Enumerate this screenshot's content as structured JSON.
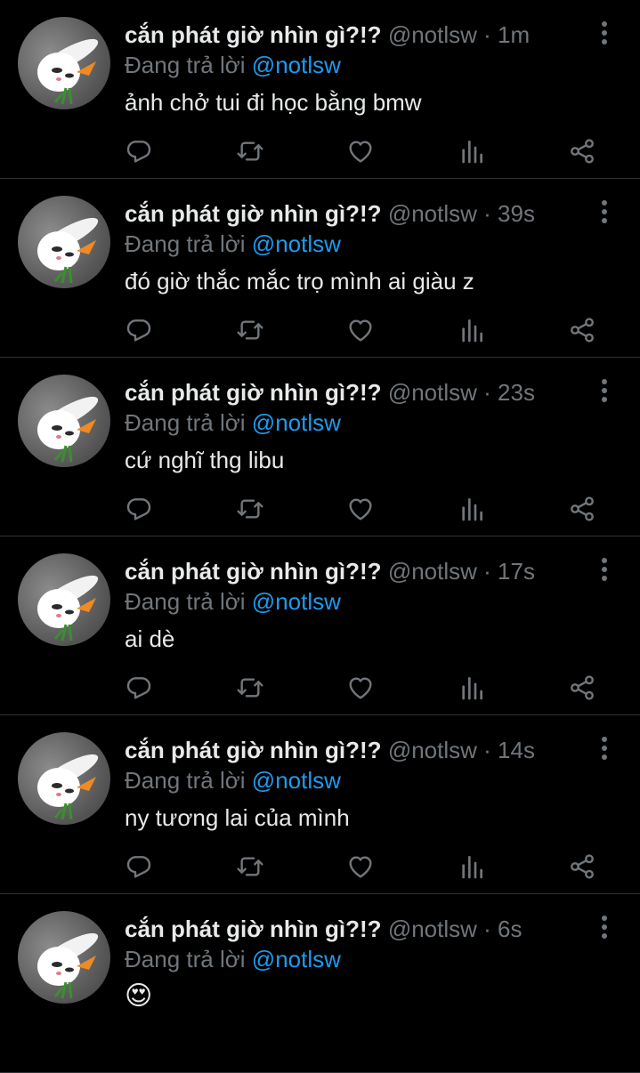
{
  "colors": {
    "background": "#000000",
    "text_primary": "#e7e9ea",
    "text_secondary": "#71767b",
    "link_blue": "#1d9bf0",
    "divider": "#2f3336"
  },
  "icons": {
    "more": "more-vertical-icon",
    "reply": "reply-icon",
    "retweet": "retweet-icon",
    "like": "heart-icon",
    "views": "views-chart-icon",
    "share": "share-icon",
    "avatar": "rabbit-avatar"
  },
  "tweets": [
    {
      "display_name": "cắn phát giờ nhìn gì?!?",
      "handle": "@notlsw",
      "separator": "·",
      "time": "1m",
      "reply_prefix": "Đang trả lời",
      "reply_to": "@notlsw",
      "text": "ảnh chở tui đi học bằng bmw"
    },
    {
      "display_name": "cắn phát giờ nhìn gì?!?",
      "handle": "@notlsw",
      "separator": "·",
      "time": "39s",
      "reply_prefix": "Đang trả lời",
      "reply_to": "@notlsw",
      "text": "đó giờ thắc mắc trọ mình ai giàu z"
    },
    {
      "display_name": "cắn phát giờ nhìn gì?!?",
      "handle": "@notlsw",
      "separator": "·",
      "time": "23s",
      "reply_prefix": "Đang trả lời",
      "reply_to": "@notlsw",
      "text": "cứ nghĩ thg libu"
    },
    {
      "display_name": "cắn phát giờ nhìn gì?!?",
      "handle": "@notlsw",
      "separator": "·",
      "time": "17s",
      "reply_prefix": "Đang trả lời",
      "reply_to": "@notlsw",
      "text": "ai dè"
    },
    {
      "display_name": "cắn phát giờ nhìn gì?!?",
      "handle": "@notlsw",
      "separator": "·",
      "time": "14s",
      "reply_prefix": "Đang trả lời",
      "reply_to": "@notlsw",
      "text": "ny tương lai của mình"
    },
    {
      "display_name": "cắn phát giờ nhìn gì?!?",
      "handle": "@notlsw",
      "separator": "·",
      "time": "6s",
      "reply_prefix": "Đang trả lời",
      "reply_to": "@notlsw",
      "text": "😍"
    }
  ]
}
